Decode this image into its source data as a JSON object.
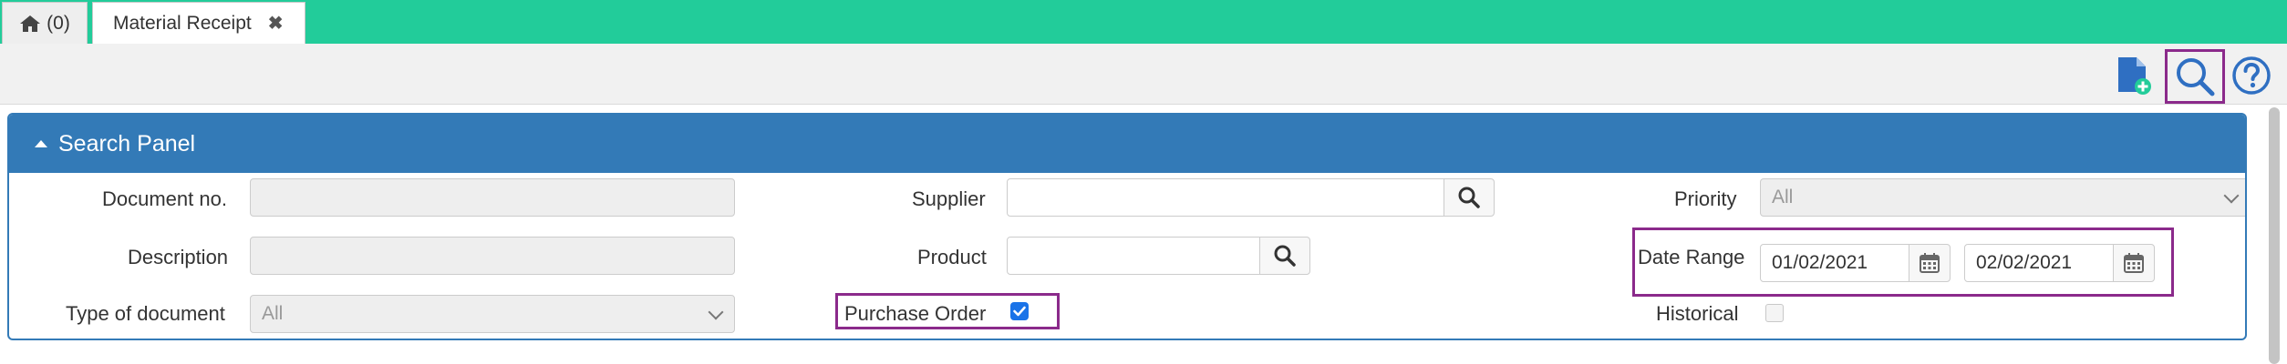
{
  "tabs": {
    "home": {
      "count_label": "(0)"
    },
    "active": {
      "label": "Material Receipt",
      "close_glyph": "✖"
    }
  },
  "toolbar": {
    "icons": [
      "new-document-icon",
      "search-icon",
      "help-icon"
    ]
  },
  "search_panel": {
    "title": "Search Panel",
    "document_no": {
      "label": "Document no.",
      "value": ""
    },
    "description": {
      "label": "Description",
      "value": ""
    },
    "type_of_document": {
      "label": "Type of document",
      "selected": "All"
    },
    "supplier": {
      "label": "Supplier",
      "value": ""
    },
    "product": {
      "label": "Product",
      "value": ""
    },
    "purchase_order": {
      "label": "Purchase Order",
      "checked": true
    },
    "priority": {
      "label": "Priority",
      "selected": "All"
    },
    "date_range": {
      "label": "Date Range",
      "from": "01/02/2021",
      "to": "02/02/2021"
    },
    "historical": {
      "label": "Historical",
      "checked": false
    }
  },
  "colors": {
    "tab_bar": "#22cc9a",
    "panel_header": "#337ab7",
    "highlight": "#8b2a8b",
    "icon_blue": "#2f6fc2",
    "checkbox_checked": "#1a73e8"
  }
}
